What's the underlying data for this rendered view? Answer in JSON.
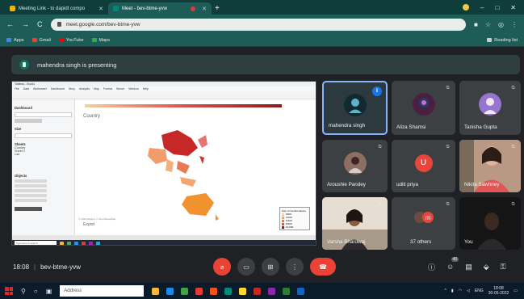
{
  "browser": {
    "tabs": [
      {
        "title": "Meeting Link - to dapidt compo",
        "active": false
      },
      {
        "title": "Meet - bev-btme-yvw",
        "active": true
      }
    ],
    "url": "meet.google.com/bev-btme-yvw",
    "bookmarks": [
      "Apps",
      "Gmail",
      "YouTube",
      "Maps"
    ],
    "reading_list": "Reading list"
  },
  "meet": {
    "presenting_text": "mahendra singh is presenting",
    "time": "18:08",
    "meeting_code": "bev-btme-yvw",
    "participant_badge": "40",
    "participants": [
      {
        "name": "mahendra singh",
        "speaking": true
      },
      {
        "name": "Aliza Shamsi"
      },
      {
        "name": "Tanisha Gupta"
      },
      {
        "name": "Aroushie Pandey"
      },
      {
        "name": "uditi priya",
        "initial": "U"
      },
      {
        "name": "Nikita Sawhney"
      },
      {
        "name": "Varsha Bhardwaj"
      },
      {
        "name": "37 others",
        "initial": "m"
      },
      {
        "name": "You"
      }
    ]
  },
  "shared_screen": {
    "title_text": "Tableau - Book1",
    "menu": [
      "File",
      "Data",
      "Worksheet",
      "Dashboard",
      "Story",
      "Analysis",
      "Map",
      "Format",
      "Server",
      "Window",
      "Help"
    ],
    "left_headers": [
      "Dashboard",
      "Size",
      "Sheets",
      "Objects"
    ],
    "left_sheets": [
      "Country",
      "Sheet 2",
      "Lab"
    ],
    "view_title": "Country",
    "view_subtitle": "Export",
    "taskbar_search": "Type here to search",
    "legend_title": "Sum of Conformations",
    "legend_items": [
      "2000",
      "4,000",
      "6,000",
      "8,000",
      "10,000"
    ]
  },
  "windows": {
    "search_placeholder": "Address",
    "clock_time": "18:08",
    "clock_date": "30-05-2022",
    "lang": "ENG"
  }
}
